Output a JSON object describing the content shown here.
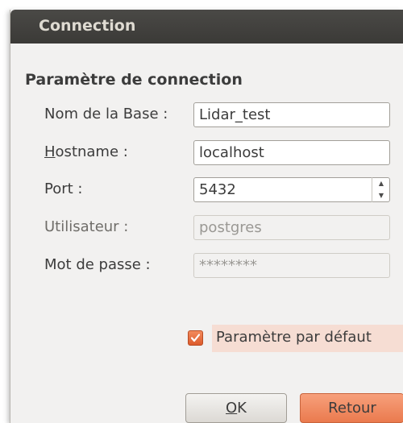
{
  "window": {
    "title": "Connection"
  },
  "group": {
    "title": "Paramètre de connection"
  },
  "fields": {
    "base": {
      "label": "Nom de la Base :",
      "value": "Lidar_test"
    },
    "hostname": {
      "label_mnemonic": "H",
      "label_rest": "ostname :",
      "value": "localhost"
    },
    "port": {
      "label": "Port :",
      "value": "5432"
    },
    "user": {
      "label": "Utilisateur :",
      "value": "postgres"
    },
    "password": {
      "label": "Mot de passe :",
      "value": "********"
    }
  },
  "default_checkbox": {
    "label": "Paramètre par défaut",
    "checked": true
  },
  "buttons": {
    "ok_mnemonic": "O",
    "ok_rest": "K",
    "back": "Retour"
  },
  "colors": {
    "accent": "#e8703f",
    "titlebar": "#3c3b37"
  }
}
